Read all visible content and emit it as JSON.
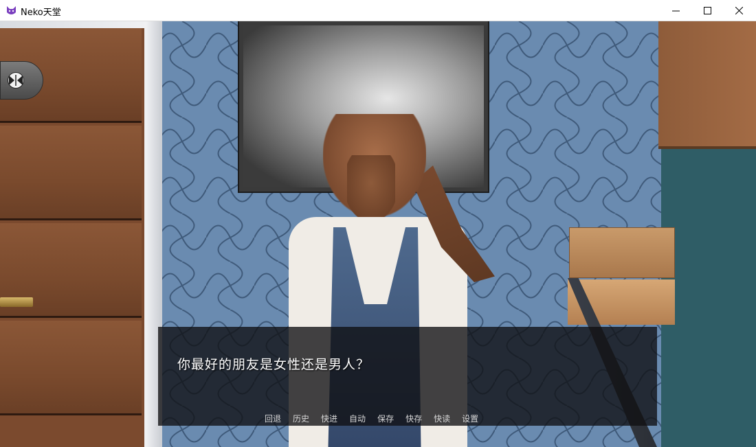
{
  "window": {
    "title": "Neko天堂",
    "controls": [
      "minimize",
      "maximize",
      "close"
    ]
  },
  "icons": {
    "app": "cat-face-icon",
    "side_toggle": "skip-arrows-icon"
  },
  "dialogue": {
    "text": "你最好的朋友是女性还是男人？"
  },
  "quick_menu": [
    {
      "label": "回退"
    },
    {
      "label": "历史"
    },
    {
      "label": "快进"
    },
    {
      "label": "自动"
    },
    {
      "label": "保存"
    },
    {
      "label": "快存"
    },
    {
      "label": "快读"
    },
    {
      "label": "设置"
    }
  ],
  "colors": {
    "dialogue_bg": "#0f0f12",
    "wallpaper": "#6a8bb0",
    "door_wood": "#7b4a2e"
  }
}
